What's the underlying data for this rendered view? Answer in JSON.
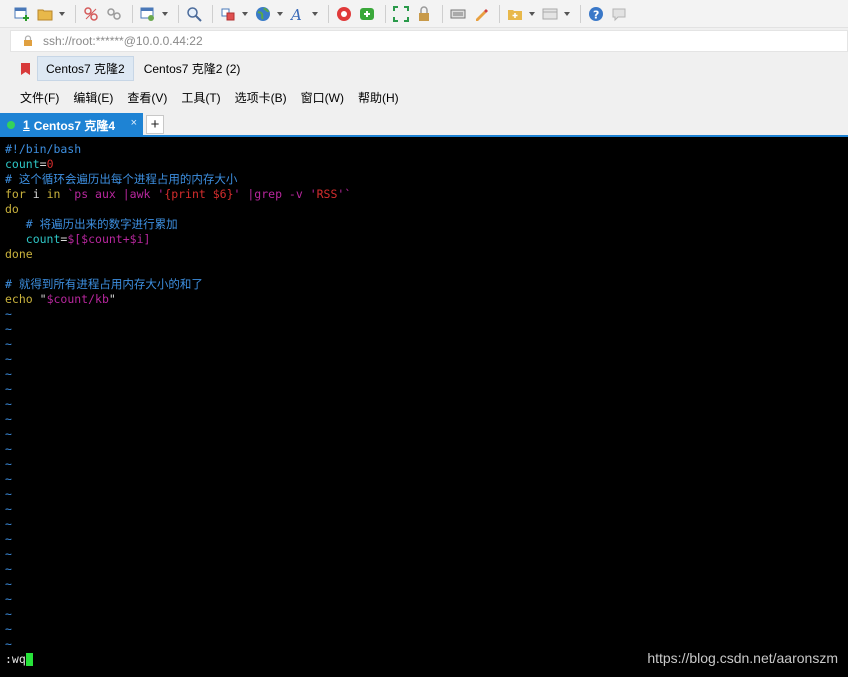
{
  "toolbar": {
    "icons": [
      "new-session-icon",
      "open-folder-icon",
      "disconnect-icon",
      "reconnect-icon",
      "properties-icon",
      "find-icon",
      "transfer-icon",
      "globe-icon",
      "font-icon",
      "xshell-icon",
      "xftp-icon",
      "fullscreen-icon",
      "lock-icon",
      "keyboard-icon",
      "highlight-icon",
      "new-tab-group-icon",
      "layout-icon",
      "help-icon",
      "chat-icon"
    ]
  },
  "address": {
    "text": "ssh://root:******@10.0.0.44:22"
  },
  "links": {
    "items": [
      "Centos7 克隆2",
      "Centos7 克隆2 (2)"
    ]
  },
  "menu": {
    "items": [
      "文件(F)",
      "编辑(E)",
      "查看(V)",
      "工具(T)",
      "选项卡(B)",
      "窗口(W)",
      "帮助(H)"
    ]
  },
  "tab": {
    "number": "1",
    "title": "Centos7 克隆4",
    "close": "×",
    "add": "+"
  },
  "terminal": {
    "shebang": "#!/bin/bash",
    "count_var": "count",
    "count_eq": "=",
    "count_val": "0",
    "comment1": "# 这个循环会遍历出每个进程占用的内存大小",
    "for_kw": "for",
    "for_i": " i ",
    "for_in": "in",
    "for_cmd_open": " `ps aux |awk '",
    "for_awk": "{print $6}",
    "for_cmd_mid": "' |grep -v '",
    "for_rss": "RSS",
    "for_cmd_close": "'`",
    "do_kw": "do",
    "comment2": "   # 将遍历出来的数字进行累加",
    "count_indent": "   count",
    "count_expr_eq": "=",
    "count_expr": "$[$count+$i]",
    "done_kw": "done",
    "comment3": "# 就得到所有进程占用内存大小的和了",
    "echo_kw": "echo",
    "echo_quote1": " \"",
    "echo_str": "$count/kb",
    "echo_quote2": "\"",
    "tilde": "~",
    "command": ":wq"
  },
  "watermark": "https://blog.csdn.net/aaronszm",
  "colors": {
    "accent": "#1e83d4",
    "terminal_bg": "#000000",
    "cursor": "#27e33a"
  }
}
